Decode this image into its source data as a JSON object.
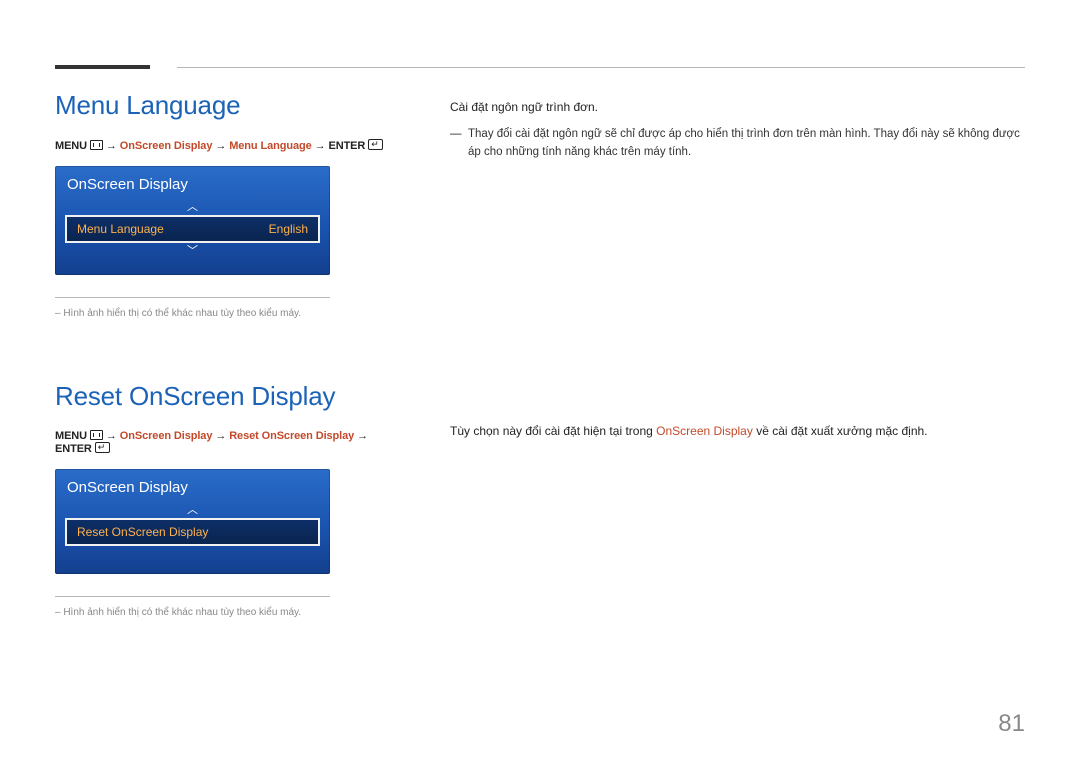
{
  "section1": {
    "title": "Menu Language",
    "breadcrumb": {
      "prefix": "MENU ",
      "path1": "OnScreen Display",
      "path2": "Menu Language",
      "suffix": "ENTER "
    },
    "osd": {
      "header": "OnScreen Display",
      "row_label": "Menu Language",
      "row_value": "English"
    },
    "footnote": "– Hình ảnh hiển thị có thể khác nhau tùy theo kiểu máy."
  },
  "section1_right": {
    "line1": "Cài đặt ngôn ngữ trình đơn.",
    "note": "Thay đổi cài đặt ngôn ngữ sẽ chỉ được áp cho hiển thị trình đơn trên màn hình. Thay đổi này sẽ không được áp cho những tính năng khác trên máy tính."
  },
  "section2": {
    "title": "Reset OnScreen Display",
    "breadcrumb": {
      "prefix": "MENU ",
      "path1": "OnScreen Display",
      "path2": "Reset OnScreen Display",
      "suffix": "ENTER "
    },
    "osd": {
      "header": "OnScreen Display",
      "row_label": "Reset OnScreen Display"
    },
    "footnote": "– Hình ảnh hiển thị có thể khác nhau tùy theo kiểu máy."
  },
  "section2_right": {
    "pre": "Tùy chọn này đổi cài đặt hiện tại trong ",
    "hl": "OnScreen Display",
    "post": " về cài đặt xuất xưởng mặc định."
  },
  "page_number": "81",
  "glyphs": {
    "arrow": "→",
    "chev_up": "︿",
    "chev_down": "﹀"
  }
}
